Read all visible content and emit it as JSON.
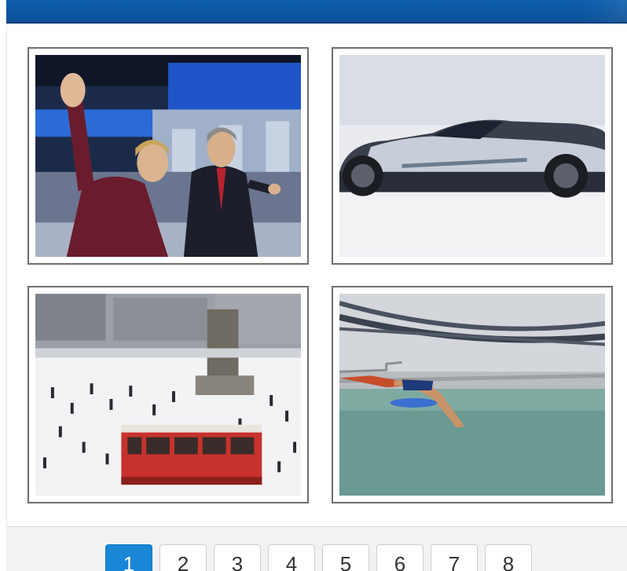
{
  "gallery": {
    "images": [
      {
        "name": "photo-waving-couple"
      },
      {
        "name": "photo-concept-car"
      },
      {
        "name": "photo-snowy-square-tram"
      },
      {
        "name": "photo-bridge-swimmer"
      }
    ]
  },
  "pagination": {
    "pages": [
      "1",
      "2",
      "3",
      "4",
      "5",
      "6",
      "7",
      "8"
    ],
    "current": "1",
    "active_color": "#1a86d6"
  },
  "colors": {
    "header": "#0b57a5",
    "thumb_border": "#6e6e6e",
    "pager_bg": "#f2f2f2"
  }
}
